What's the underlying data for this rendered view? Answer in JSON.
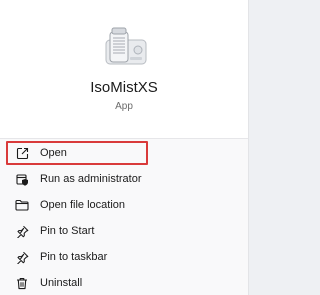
{
  "app": {
    "name": "IsoMistXS",
    "type": "App",
    "icon": "humidifier-app-icon"
  },
  "menu": {
    "items": [
      {
        "label": "Open",
        "icon": "open-external-icon",
        "highlighted": true
      },
      {
        "label": "Run as administrator",
        "icon": "shield-admin-icon"
      },
      {
        "label": "Open file location",
        "icon": "folder-icon"
      },
      {
        "label": "Pin to Start",
        "icon": "pin-icon"
      },
      {
        "label": "Pin to taskbar",
        "icon": "pin-icon"
      },
      {
        "label": "Uninstall",
        "icon": "trash-icon"
      }
    ]
  },
  "colors": {
    "highlight_border": "#d93a3a",
    "panel_bg": "#f9f9fa",
    "hero_bg": "#ffffff"
  }
}
